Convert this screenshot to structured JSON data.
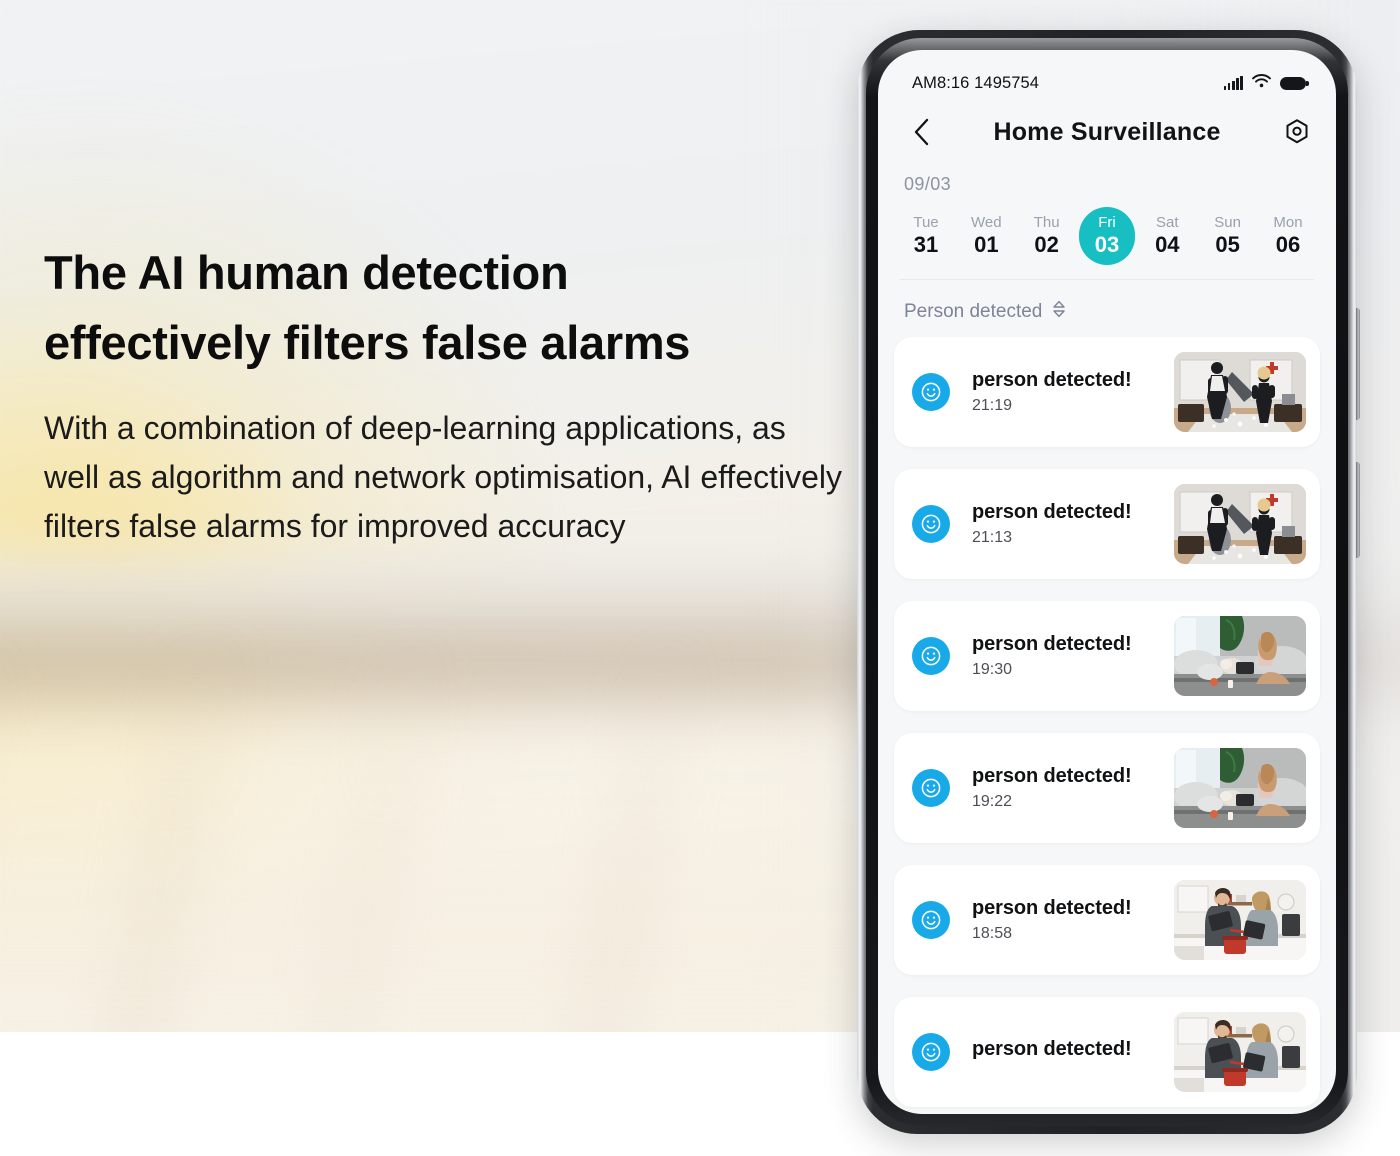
{
  "promo": {
    "headline_line1": "The AI human detection",
    "headline_line2": "effectively filters false alarms",
    "body": "With a combination of deep-learning applications, as well as algorithm and network optimisation, AI effectively filters false alarms for improved accuracy"
  },
  "phone": {
    "status_bar": {
      "left_text": "AM8:16 1495754",
      "signal_icon": "cellular-signal-icon",
      "wifi_icon": "wifi-icon",
      "battery_icon": "battery-icon"
    },
    "nav": {
      "back_icon": "chevron-left-icon",
      "title": "Home  Surveillance",
      "settings_icon": "hex-gear-icon"
    },
    "calendar": {
      "month_label": "09/03",
      "selected_index": 3,
      "accent_color": "#17bfc2",
      "days": [
        {
          "dow": "Tue",
          "num": "31"
        },
        {
          "dow": "Wed",
          "num": "01"
        },
        {
          "dow": "Thu",
          "num": "02"
        },
        {
          "dow": "Fri",
          "num": "03"
        },
        {
          "dow": "Sat",
          "num": "04"
        },
        {
          "dow": "Sun",
          "num": "05"
        },
        {
          "dow": "Mon",
          "num": "06"
        }
      ]
    },
    "filter": {
      "label": "Person detected",
      "chevron_icon": "chevron-updown-icon"
    },
    "events": [
      {
        "title": "person detected!",
        "time": "21:19",
        "avatar_icon": "smiley-face-icon",
        "thumb": "pillow-fight"
      },
      {
        "title": "person detected!",
        "time": "21:13",
        "avatar_icon": "smiley-face-icon",
        "thumb": "pillow-fight"
      },
      {
        "title": "person detected!",
        "time": "19:30",
        "avatar_icon": "smiley-face-icon",
        "thumb": "couch-woman"
      },
      {
        "title": "person detected!",
        "time": "19:22",
        "avatar_icon": "smiley-face-icon",
        "thumb": "couch-woman"
      },
      {
        "title": "person detected!",
        "time": "18:58",
        "avatar_icon": "smiley-face-icon",
        "thumb": "kitchen-couple"
      },
      {
        "title": "person detected!",
        "time": "",
        "avatar_icon": "smiley-face-icon",
        "thumb": "kitchen-couple"
      }
    ],
    "colors": {
      "avatar_blue": "#18a9e8",
      "screen_bg": "#f6f7f8",
      "card_bg": "#ffffff",
      "muted_text": "#7d8399"
    }
  }
}
